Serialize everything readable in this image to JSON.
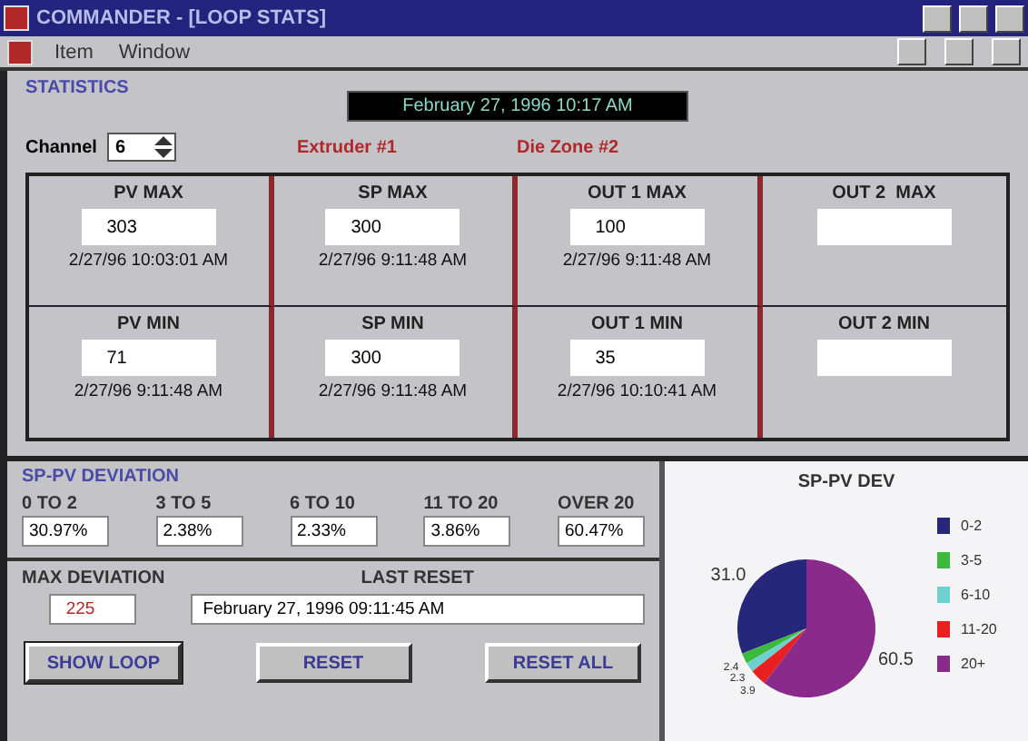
{
  "window": {
    "title": "COMMANDER - [LOOP STATS]"
  },
  "menu": [
    "Item",
    "Window"
  ],
  "statistics": {
    "heading": "STATISTICS",
    "datetime": "February 27, 1996 10:17 AM",
    "channel_label": "Channel",
    "channel": "6",
    "extruder": "Extruder #1",
    "zone": "Die Zone #2",
    "rows": [
      [
        {
          "label": "PV MAX",
          "value": "303",
          "time": "2/27/96 10:03:01 AM"
        },
        {
          "label": "SP MAX",
          "value": "300",
          "time": "2/27/96 9:11:48 AM"
        },
        {
          "label": "OUT 1 MAX",
          "value": "100",
          "time": "2/27/96 9:11:48 AM"
        },
        {
          "label": "OUT 2  MAX"
        }
      ],
      [
        {
          "label": "PV MIN",
          "value": "71",
          "time": "2/27/96 9:11:48 AM"
        },
        {
          "label": "SP MIN",
          "value": "300",
          "time": "2/27/96 9:11:48 AM"
        },
        {
          "label": "OUT 1 MIN",
          "value": "35",
          "time": "2/27/96 10:10:41 AM"
        },
        {
          "label": "OUT 2 MIN"
        }
      ]
    ]
  },
  "deviation": {
    "heading": "SP-PV DEVIATION",
    "bins": [
      {
        "label": "0 TO 2",
        "value": "30.97%"
      },
      {
        "label": "3 TO 5",
        "value": "2.38%"
      },
      {
        "label": "6 TO 10",
        "value": "2.33%"
      },
      {
        "label": "11 TO 20",
        "value": "3.86%"
      },
      {
        "label": "OVER 20",
        "value": "60.47%"
      }
    ],
    "max_deviation": {
      "label": "MAX DEVIATION",
      "value": "225"
    },
    "last_reset": {
      "label": "LAST RESET",
      "value": "February 27, 1996 09:11:45 AM"
    },
    "buttons": [
      "SHOW LOOP",
      "RESET",
      "RESET ALL"
    ]
  },
  "chart": {
    "chart_data": {
      "type": "pie",
      "title": "SP-PV DEV",
      "categories": [
        "0-2",
        "3-5",
        "6-10",
        "11-20",
        "20+"
      ],
      "series": [
        {
          "values": [
            31.0,
            2.4,
            2.3,
            3.9,
            60.5
          ]
        }
      ],
      "colors": [
        "#26267a",
        "#3cb83c",
        "#6fd0d0",
        "#e82020",
        "#8a2a8a"
      ],
      "value_labels": [
        "31.0",
        "2.4",
        "2.3",
        "3.9",
        "60.5"
      ],
      "legend": "right"
    }
  }
}
